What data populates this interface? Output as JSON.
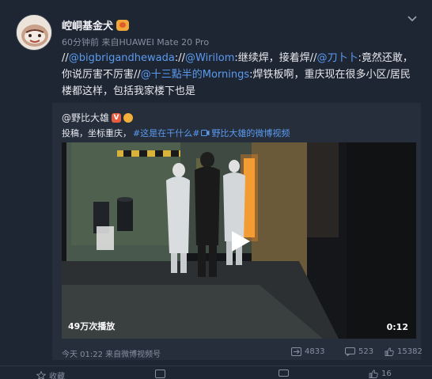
{
  "post": {
    "username": "崆峒基金犬",
    "meta": "60分钟前 来自HUAWEI Mate 20 Pro",
    "text": {
      "p1": "//",
      "m1": "@bigbrigandhewada",
      "p2": "://",
      "m2": "@Wirilom",
      "p3": ":继续焊，接着焊//",
      "m3": "@刀卜卜",
      "p4": ":竟然还敢，你说厉害不厉害//",
      "m4": "@十三點半的Mornings",
      "p5": ":焊铁板啊，重庆现在很多小区/居民楼都这样，包括我家楼下也是"
    }
  },
  "repost": {
    "author": "@野比大雄",
    "v_badge": "V",
    "text_prefix": "投稿，坐标重庆，",
    "hashtag": "#这是在干什么#",
    "video_link": "野比大雄的微博视频",
    "video": {
      "views": "49万次播放",
      "duration": "0:12"
    },
    "footer": {
      "time": "今天 01:22 来自微博视频号",
      "reposts": "4833",
      "comments": "523",
      "likes": "15382"
    }
  },
  "bottom_bar": {
    "repost_label": "收藏",
    "like_count": "16"
  },
  "colors": {
    "background": "#1f2633",
    "mention": "#5a9bf0",
    "secondary_text": "#8790a0"
  }
}
